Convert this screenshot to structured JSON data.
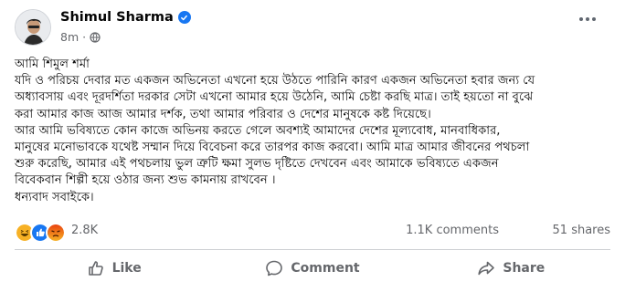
{
  "post": {
    "author": "Shimul Sharma",
    "time": "8m",
    "separator": "·",
    "lines": [
      "আমি শিমুল শর্মা",
      "যদি ও পরিচয় দেবার মত একজন অভিনেতা এখনো হয়ে উঠতে পারিনি কারণ একজন অভিনেতা হবার জন্য যে",
      "অধ্যাবসায় এবং দূরদর্শিতা দরকার সেটা এখনো আমার হয়ে উঠেনি, আমি চেষ্টা করছি মাত্র। তাই হয়তো না বুঝে",
      "করা আমার কাজ আজ আমার দর্শক, তথা আমার পরিবার ও দেশের মানুষকে কষ্ট দিয়েছে।",
      "আর আমি ভবিষ্যতে কোন কাজে অভিনয় করতে গেলে অবশ্যই আমাদের দেশের মূল্যবোধ, মানবাধিকার,",
      "মানুষের মনোভাবকে যথেষ্ট সম্মান দিয়ে বিবেচনা করে তারপর কাজ করবো। আমি মাত্র আমার জীবনের পথচলা",
      "শুরু করেছি, আমার এই পথচলায় ভুল ত্রুটি ক্ষমা সুলভ দৃষ্টিতে দেখবেন এবং আমাকে ভবিষ্যতে একজন",
      "বিবেকবান শিল্পী হয়ে ওঠার জন্য শুভ কামনায় রাখবেন ।",
      "ধন্যবাদ সবাইকে।"
    ]
  },
  "stats": {
    "reactions": "2.8K",
    "comments": "1.1K comments",
    "shares": "51 shares",
    "reaction_icons": [
      "haha",
      "like",
      "angry"
    ]
  },
  "actions": {
    "like": "Like",
    "comment": "Comment",
    "share": "Share"
  },
  "colors": {
    "verified": "#1877f2",
    "like": "#1877f2",
    "haha": "#f7b125",
    "angry": "#e9710f",
    "muted": "#65676b"
  }
}
